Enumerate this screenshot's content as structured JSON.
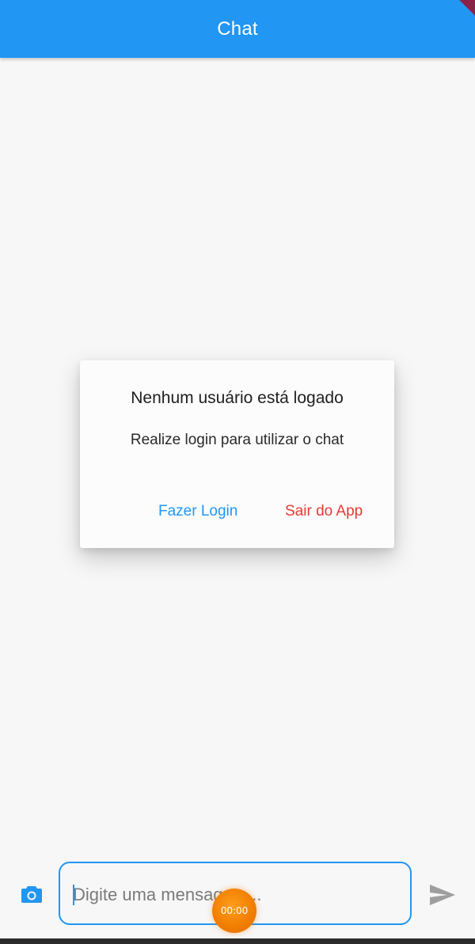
{
  "appbar": {
    "title": "Chat",
    "color": "#2196f3"
  },
  "dialog": {
    "title": "Nenhum usuário está logado",
    "content": "Realize login para utilizar o chat",
    "actions": {
      "login_label": "Fazer Login",
      "exit_label": "Sair do App"
    },
    "colors": {
      "login": "#2196f3",
      "exit": "#e53935"
    }
  },
  "composer": {
    "placeholder": "Digite uma mensagem...",
    "value": "",
    "camera_icon": "camera-icon",
    "send_icon": "send-icon"
  },
  "recorder": {
    "time": "00:00",
    "color": "#f07d00"
  }
}
